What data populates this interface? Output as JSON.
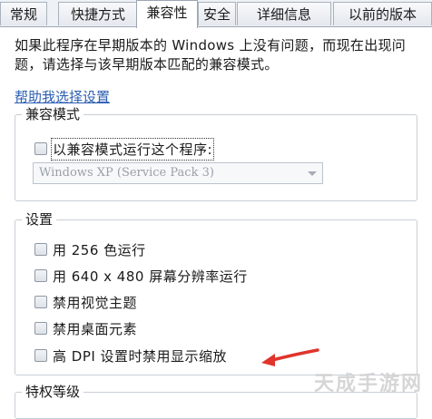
{
  "tabs": [
    {
      "label": "常规",
      "active": false
    },
    {
      "label": "快捷方式",
      "active": false
    },
    {
      "label": "兼容性",
      "active": true
    },
    {
      "label": "安全",
      "active": false
    },
    {
      "label": "详细信息",
      "active": false
    },
    {
      "label": "以前的版本",
      "active": false
    }
  ],
  "intro_text": "如果此程序在早期版本的 Windows 上没有问题，而现在出现问题，请选择与该早期版本匹配的兼容模式。",
  "help_link": "帮助我选择设置",
  "compat_group": {
    "title": "兼容模式",
    "run_in_compat_mode": {
      "label": "以兼容模式运行这个程序:",
      "checked": false
    },
    "os_select": {
      "value": "Windows XP (Service Pack 3)",
      "enabled": false
    }
  },
  "settings_group": {
    "title": "设置",
    "options": [
      {
        "label": "用 256 色运行",
        "checked": false
      },
      {
        "label": "用 640 x 480 屏幕分辨率运行",
        "checked": false
      },
      {
        "label": "禁用视觉主题",
        "checked": false
      },
      {
        "label": "禁用桌面元素",
        "checked": false
      },
      {
        "label": "高 DPI 设置时禁用显示缩放",
        "checked": false
      }
    ]
  },
  "privilege_group": {
    "title": "特权等级"
  },
  "watermark": "天成手游网",
  "colors": {
    "link": "#2a5db0",
    "annotation_arrow": "#e0342c"
  }
}
